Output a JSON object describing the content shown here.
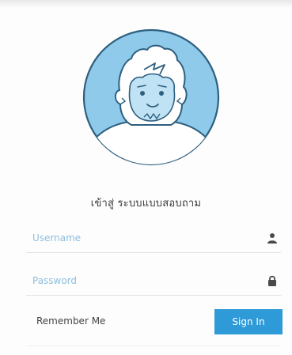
{
  "login": {
    "title": "เข้าสู่ ระบบแบบสอบถาม",
    "username_placeholder": "Username",
    "password_placeholder": "Password",
    "remember_label": "Remember Me",
    "signin_label": "Sign In"
  },
  "icons": {
    "username": "user-icon",
    "password": "lock-icon",
    "avatar": "yeti-avatar"
  },
  "colors": {
    "accent": "#2f9ad8",
    "avatar_bg": "#8fcaea",
    "avatar_outline": "#2e5f7f",
    "placeholder": "#8fbddd"
  }
}
